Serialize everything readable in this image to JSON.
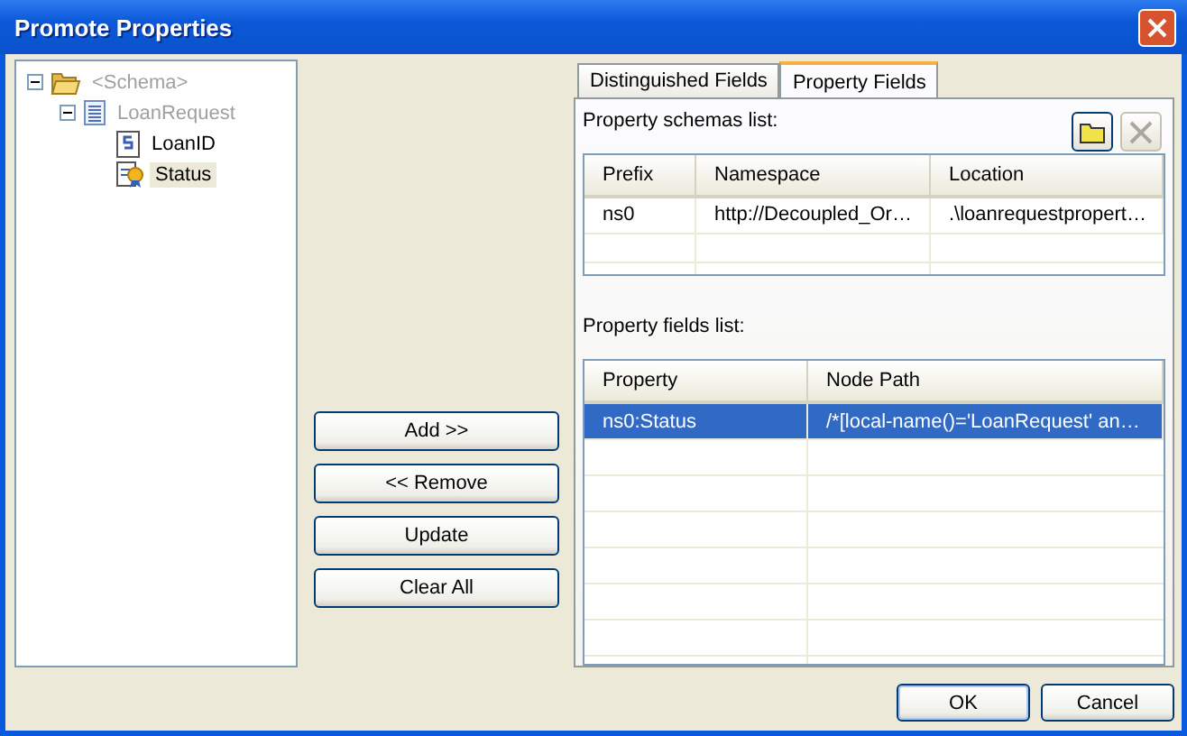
{
  "window": {
    "title": "Promote Properties"
  },
  "tree": [
    {
      "label": "<Schema>",
      "kind": "folder",
      "disabled": true,
      "expanded": true,
      "selected": false,
      "children": [
        {
          "label": "LoanRequest",
          "kind": "record",
          "disabled": true,
          "expanded": true,
          "selected": false,
          "children": [
            {
              "label": "LoanID",
              "kind": "field",
              "disabled": false,
              "selected": false
            },
            {
              "label": "Status",
              "kind": "property",
              "disabled": false,
              "selected": true
            }
          ]
        }
      ]
    }
  ],
  "actions": [
    {
      "label": "Add >>"
    },
    {
      "label": "<< Remove"
    },
    {
      "label": "Update"
    },
    {
      "label": "Clear All"
    }
  ],
  "tabs": [
    {
      "label": "Distinguished Fields",
      "selected": false
    },
    {
      "label": "Property Fields",
      "selected": true
    }
  ],
  "schemas": {
    "label": "Property schemas list:",
    "tools": [
      {
        "kind": "open",
        "disabled": false
      },
      {
        "kind": "delete",
        "disabled": true
      }
    ],
    "columns": [
      "Prefix",
      "Namespace",
      "Location"
    ],
    "rows": [
      {
        "cells": [
          "ns0",
          "http://Decoupled_Or…",
          ".\\loanrequestpropert…"
        ],
        "selected": false
      }
    ]
  },
  "fields": {
    "label": "Property fields list:",
    "columns": [
      "Property",
      "Node Path"
    ],
    "rows": [
      {
        "cells": [
          "ns0:Status",
          "/*[local-name()='LoanRequest' an…"
        ],
        "selected": true
      }
    ]
  },
  "buttons": [
    {
      "label": "OK",
      "default": true
    },
    {
      "label": "Cancel",
      "default": false
    }
  ]
}
